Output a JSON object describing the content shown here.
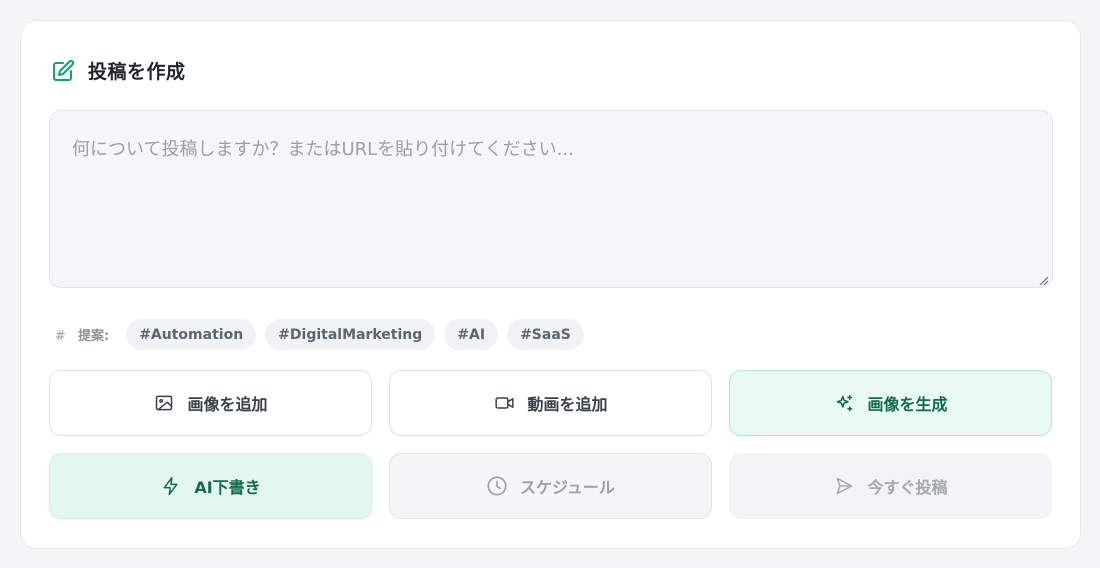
{
  "composer": {
    "title": "投稿を作成",
    "placeholder": "何について投稿しますか？またはURLを貼り付けてください...",
    "value": ""
  },
  "suggestions": {
    "icon": "hash-icon",
    "icon_glyph": "#",
    "label": "提案:",
    "tags": [
      "#Automation",
      "#DigitalMarketing",
      "#AI",
      "#SaaS"
    ]
  },
  "actions": {
    "add_image": {
      "label": "画像を追加",
      "icon": "image-icon"
    },
    "add_video": {
      "label": "動画を追加",
      "icon": "video-icon"
    },
    "generate_image": {
      "label": "画像を生成",
      "icon": "sparkles-icon"
    },
    "ai_draft": {
      "label": "AI下書き",
      "icon": "lightning-icon"
    },
    "schedule": {
      "label": "スケジュール",
      "icon": "clock-icon"
    },
    "post_now": {
      "label": "今すぐ投稿",
      "icon": "send-icon"
    }
  },
  "colors": {
    "accent": "#0f6b4c",
    "accent_bg": "#e8faf2",
    "header_icon": "#13a07a"
  }
}
